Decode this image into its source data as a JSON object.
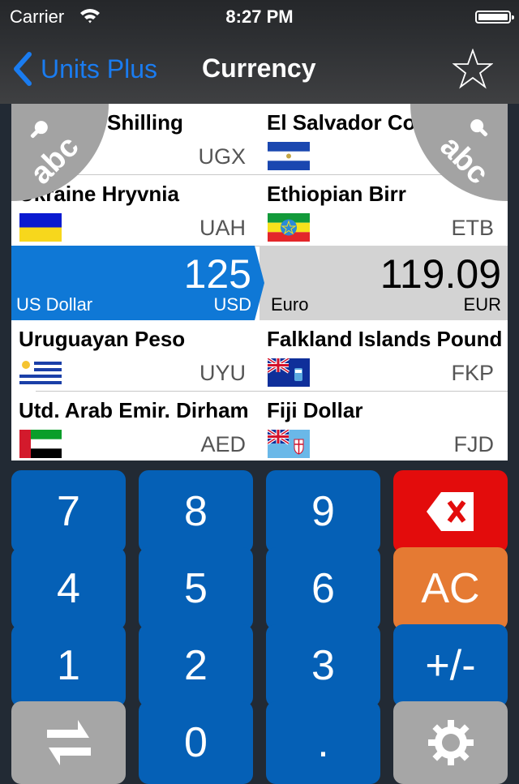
{
  "status_bar": {
    "carrier": "Carrier",
    "time": "8:27 PM",
    "wifi_icon": "wifi-icon",
    "battery_icon": "battery-full-icon"
  },
  "nav": {
    "back_label": "Units Plus",
    "title": "Currency",
    "favorite_icon": "star-outline-icon"
  },
  "colors": {
    "accent": "#1a7cf0",
    "selected_from": "#0f78d6",
    "selected_to": "#d3d3d3",
    "key_blue": "#0560b6",
    "key_red": "#e30c0c",
    "key_orange": "#e57a33",
    "key_gray": "#a6a6a6"
  },
  "currency_list": {
    "left": [
      {
        "name": "Uganda Shilling",
        "visible_name": "Shilling",
        "code": "UGX",
        "flag": "none"
      },
      {
        "name": "Ukraine Hryvnia",
        "code": "UAH",
        "flag": "ukraine"
      },
      {
        "name": "Uruguayan Peso",
        "code": "UYU",
        "flag": "uruguay"
      },
      {
        "name": "Utd. Arab Emir. Dirham",
        "code": "AED",
        "flag": "uae"
      }
    ],
    "right": [
      {
        "name": "El Salvador Co",
        "code": "",
        "flag": "el-salvador"
      },
      {
        "name": "Ethiopian Birr",
        "code": "ETB",
        "flag": "ethiopia"
      },
      {
        "name": "Falkland Islands Pound",
        "code": "FKP",
        "flag": "falkland"
      },
      {
        "name": "Fiji Dollar",
        "code": "FJD",
        "flag": "fiji"
      }
    ]
  },
  "conversion": {
    "from": {
      "value": "125",
      "name": "US Dollar",
      "code": "USD"
    },
    "to": {
      "value": "119.09",
      "name": "Euro",
      "code": "EUR"
    }
  },
  "index_overlay": {
    "left_label": "abc",
    "right_label": "abc",
    "icon": "search-icon"
  },
  "keypad": {
    "rows": [
      [
        "7",
        "8",
        "9",
        "backspace"
      ],
      [
        "4",
        "5",
        "6",
        "AC"
      ],
      [
        "1",
        "2",
        "3",
        "+/-"
      ],
      [
        "swap",
        "0",
        ".",
        "settings"
      ]
    ],
    "labels": {
      "k7": "7",
      "k8": "8",
      "k9": "9",
      "k4": "4",
      "k5": "5",
      "k6": "6",
      "k1": "1",
      "k2": "2",
      "k3": "3",
      "k0": "0",
      "dot": ".",
      "ac": "AC",
      "sign": "+/-"
    }
  }
}
